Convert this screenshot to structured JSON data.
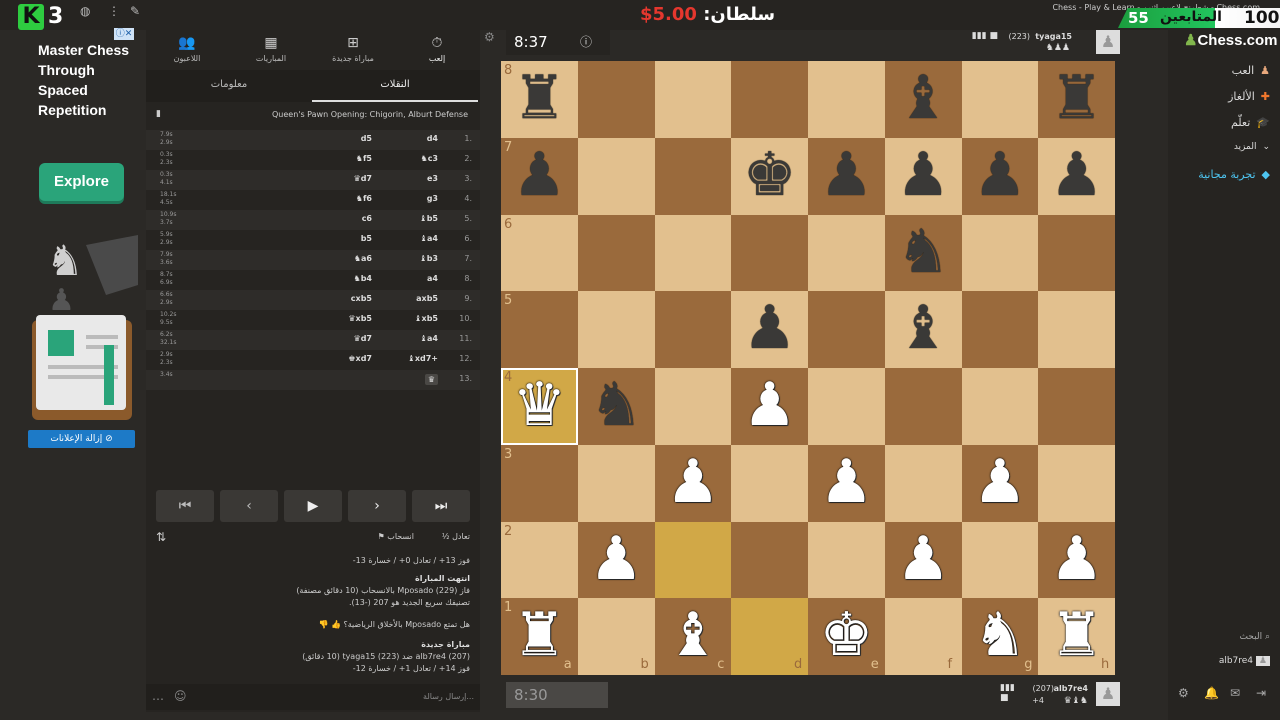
{
  "stream": {
    "logo_letter": "K",
    "logo_number": "3",
    "sultan_name": "سلطان:",
    "sultan_amount": "5.00$",
    "window_title": "Chess - Play & Learn - شطرنج لاعبين اثنين - Chess.com",
    "followers_count": "55",
    "followers_label": "المتابعين",
    "followers_goal": "100"
  },
  "ad": {
    "title": "Master Chess Through Spaced Repetition",
    "explore_label": "Explore",
    "remove_ads_label": "إزالة الإعلانات"
  },
  "panel": {
    "tabs": [
      {
        "icon": "stopwatch-icon",
        "label": "إلعب"
      },
      {
        "icon": "plus-square-icon",
        "label": "مباراة جديدة"
      },
      {
        "icon": "board-icon",
        "label": "المباريات"
      },
      {
        "icon": "players-icon",
        "label": "اللاعبون"
      }
    ],
    "subtabs": {
      "moves": "النقلات",
      "info": "معلومات"
    },
    "opening": "Queen's Pawn Opening: Chigorin, Alburt Defense",
    "moves": [
      {
        "no": "1.",
        "white": "d4",
        "black": "d5",
        "t1": "7.9s",
        "t2": "2.9s"
      },
      {
        "no": "2.",
        "white": "♞c3",
        "black": "♞f5",
        "t1": "0.3s",
        "t2": "2.3s"
      },
      {
        "no": "3.",
        "white": "e3",
        "black": "♛d7",
        "t1": "0.3s",
        "t2": "4.1s"
      },
      {
        "no": "4.",
        "white": "g3",
        "black": "♞f6",
        "t1": "18.1s",
        "t2": "4.5s"
      },
      {
        "no": "5.",
        "white": "♝b5",
        "black": "c6",
        "t1": "10.9s",
        "t2": "3.7s"
      },
      {
        "no": "6.",
        "white": "♝a4",
        "black": "b5",
        "t1": "5.9s",
        "t2": "2.9s"
      },
      {
        "no": "7.",
        "white": "♝b3",
        "black": "♞a6",
        "t1": "7.9s",
        "t2": "3.6s"
      },
      {
        "no": "8.",
        "white": "a4",
        "black": "♞b4",
        "t1": "8.7s",
        "t2": "6.9s"
      },
      {
        "no": "9.",
        "white": "axb5",
        "black": "cxb5",
        "t1": "6.6s",
        "t2": "2.9s"
      },
      {
        "no": "10.",
        "white": "♝xb5",
        "black": "♛xb5",
        "t1": "10.2s",
        "t2": "9.5s"
      },
      {
        "no": "11.",
        "white": "♝a4",
        "black": "♛d7",
        "t1": "6.2s",
        "t2": "32.1s"
      },
      {
        "no": "12.",
        "white": "♝xd7+",
        "black": "♚xd7",
        "t1": "2.9s",
        "t2": "2.3s"
      },
      {
        "no": "13.",
        "white": "♛",
        "black": "",
        "t1": "3.4s",
        "t2": ""
      }
    ],
    "actions": {
      "draw": "تعادل",
      "resign": "انسحاب"
    },
    "chat": [
      "فوز 13+ / تعادل 0+ / خسارة 13-",
      "انتهت المباراة",
      "فاز Mposado (229) بالانسحاب (10 دقائق مصنفة)",
      "تصنيفك سريع الجديد هو 207 (-13).",
      "هل تمتع Mposado بالأخلاق الرياضية؟",
      "مباراة جديدة",
      "alb7re4 (207) ضد tyaga15 (223) (10 دقائق)",
      "فوز 14+ / تعادل 1+ / خسارة 12-"
    ],
    "chat_placeholder": "إرسال رسالة..."
  },
  "game": {
    "top_clock": "8:37",
    "top_player": "tyaga15",
    "top_rating": "(223)",
    "bottom_clock": "8:30",
    "bottom_player": "alb7re4",
    "bottom_rating": "(207)",
    "bottom_material": "+4",
    "files": [
      "a",
      "b",
      "c",
      "d",
      "e",
      "f",
      "g",
      "h"
    ],
    "ranks": [
      "8",
      "7",
      "6",
      "5",
      "4",
      "3",
      "2",
      "1"
    ]
  },
  "sidebar": {
    "logo": "Chess.com",
    "items": [
      {
        "label": "العب",
        "icon": "pawn-icon"
      },
      {
        "label": "الألغاز",
        "icon": "puzzle-icon"
      },
      {
        "label": "تعلّم",
        "icon": "graduation-icon"
      },
      {
        "label": "المزيد",
        "icon": "chevron-down-icon"
      },
      {
        "label": "تجربة مجانية",
        "icon": "diamond-icon"
      }
    ],
    "search": "البحث",
    "user": "alb7re4"
  },
  "colors": {
    "accent_green": "#2aa47a",
    "board_light": "#e2c08e",
    "board_dark": "#9a6a3c",
    "highlight": "#d1a847"
  }
}
